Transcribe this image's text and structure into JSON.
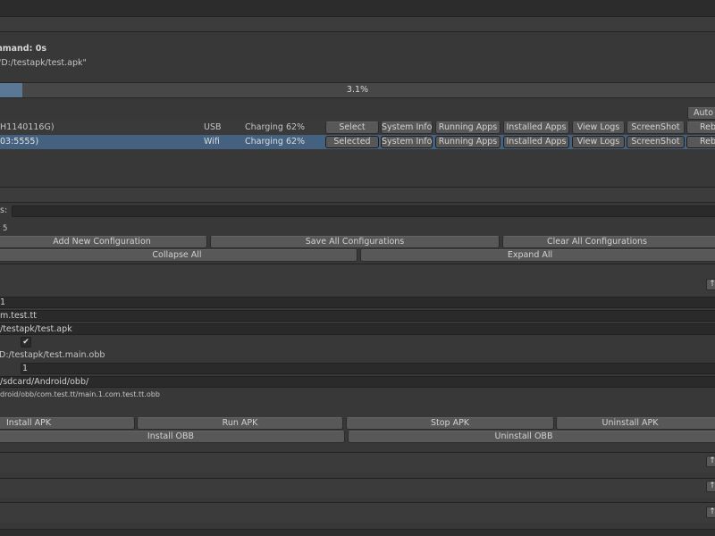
{
  "status": {
    "command_label": "...mmand: 0s",
    "command_path": "\"D:/testapk/test.apk\"",
    "progress_text": "3.1%",
    "progress_value": 0.031
  },
  "toolbar": {
    "auto_label": "Auto"
  },
  "devices": [
    {
      "name": "H1140116G)",
      "connection": "USB",
      "battery": "Charging 62%",
      "select_label": "Select",
      "actions": [
        "System Info",
        "Running Apps",
        "Installed Apps",
        "View Logs",
        "ScreenShot",
        "Reb"
      ]
    },
    {
      "name": "03:5555)",
      "connection": "Wifi",
      "battery": "Charging 62%",
      "select_label": "Selected",
      "actions": [
        "System Info",
        "Running Apps",
        "Installed Apps",
        "View Logs",
        "ScreenShot",
        "Reb"
      ]
    }
  ],
  "config": {
    "search_label": "s:",
    "count_text": "5",
    "add_label": "Add New Configuration",
    "save_label": "Save All Configurations",
    "clear_label": "Clear All Configurations",
    "collapse_label": "Collapse All",
    "expand_label": "Expand All"
  },
  "entry": {
    "index_value": "1",
    "package_value": "m.test.tt",
    "apk_path": "/testapk/test.apk",
    "obb_label": "D:/testapk/test.main.obb",
    "obb_version": "1",
    "device_obb_dir": "/sdcard/Android/obb/",
    "obb_full_path": "droid/obb/com.test.tt/main.1.com.test.tt.obb",
    "install_apk": "Install APK",
    "run_apk": "Run APK",
    "stop_apk": "Stop APK",
    "uninstall_apk": "Uninstall APK",
    "install_obb": "Install OBB",
    "uninstall_obb": "Uninstall OBB"
  },
  "colors": {
    "selected_row": "#44627f",
    "background": "#383838",
    "field": "#2a2a2a"
  }
}
